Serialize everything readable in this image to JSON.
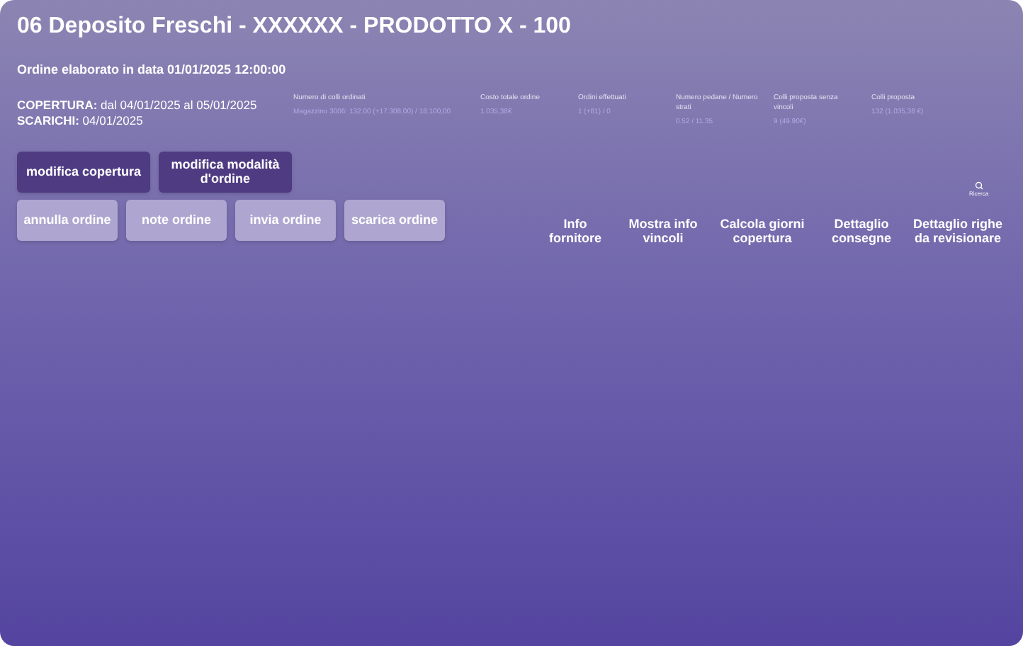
{
  "title": "06 Deposito Freschi - XXXXXX - PRODOTTO X - 100",
  "subtitle": "Ordine elaborato in data 01/01/2025 12:00:00",
  "coverage": {
    "label": "COPERTURA:",
    "value": "dal 04/01/2025 al 05/01/2025"
  },
  "unloads": {
    "label": "SCARICHI:",
    "value": "04/01/2025"
  },
  "stats": [
    {
      "label": "Numero di colli ordinati",
      "value": "Magazzino 3006: 132.00 (+17.308,00) / 18.100,00"
    },
    {
      "label": "Costo totale ordine",
      "value": "1.035,38€"
    },
    {
      "label": "Ordini effettuati",
      "value": "1 (+81) / 0"
    },
    {
      "label": "Numero pedane / Numero strati",
      "value": "0.52 / 11.35"
    },
    {
      "label": "Colli proposta senza vincoli",
      "value": "9 (49.90€)"
    },
    {
      "label": "Colli proposta",
      "value": "132 (1.035,38 €)"
    }
  ],
  "button_rows": [
    [
      {
        "label": "modifica copertura",
        "kind": "primary"
      },
      {
        "label": "modifica modalità d'ordine",
        "kind": "primary"
      }
    ],
    [
      {
        "label": "annulla ordine",
        "kind": "secondary"
      },
      {
        "label": "note ordine",
        "kind": "secondary"
      },
      {
        "label": "invia ordine",
        "kind": "secondary"
      },
      {
        "label": "scarica ordine",
        "kind": "secondary"
      }
    ]
  ],
  "search": {
    "label": "Ricerca"
  },
  "links": [
    "Info fornitore",
    "Mostra info vincoli",
    "Calcola giorni copertura",
    "Dettaglio consegne",
    "Dettaglio righe da revisionare"
  ]
}
